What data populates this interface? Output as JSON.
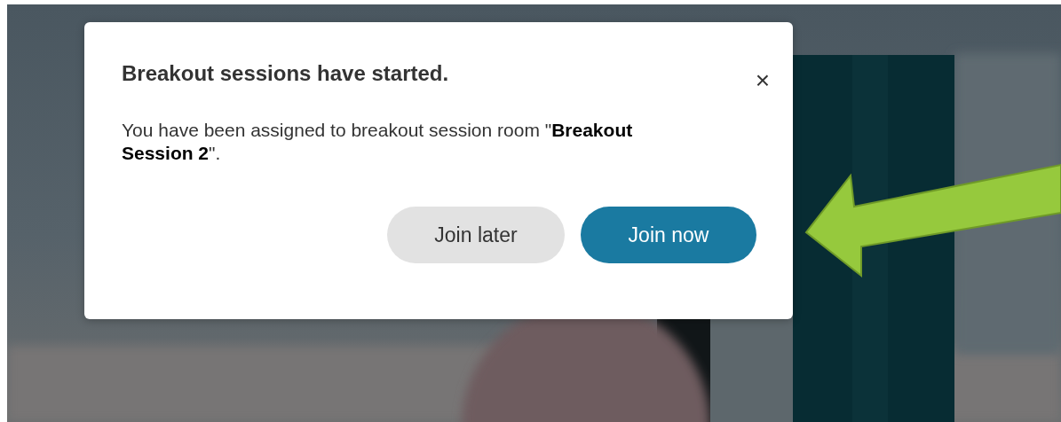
{
  "dialog": {
    "title": "Breakout sessions have started.",
    "close": "×",
    "message": "You have been assigned to breakout session room \"**Breakout Session 2**\".",
    "buttons": [
      {
        "label": "Join later",
        "kind": "secondary"
      },
      {
        "label": "Join now",
        "kind": "primary"
      }
    ]
  }
}
